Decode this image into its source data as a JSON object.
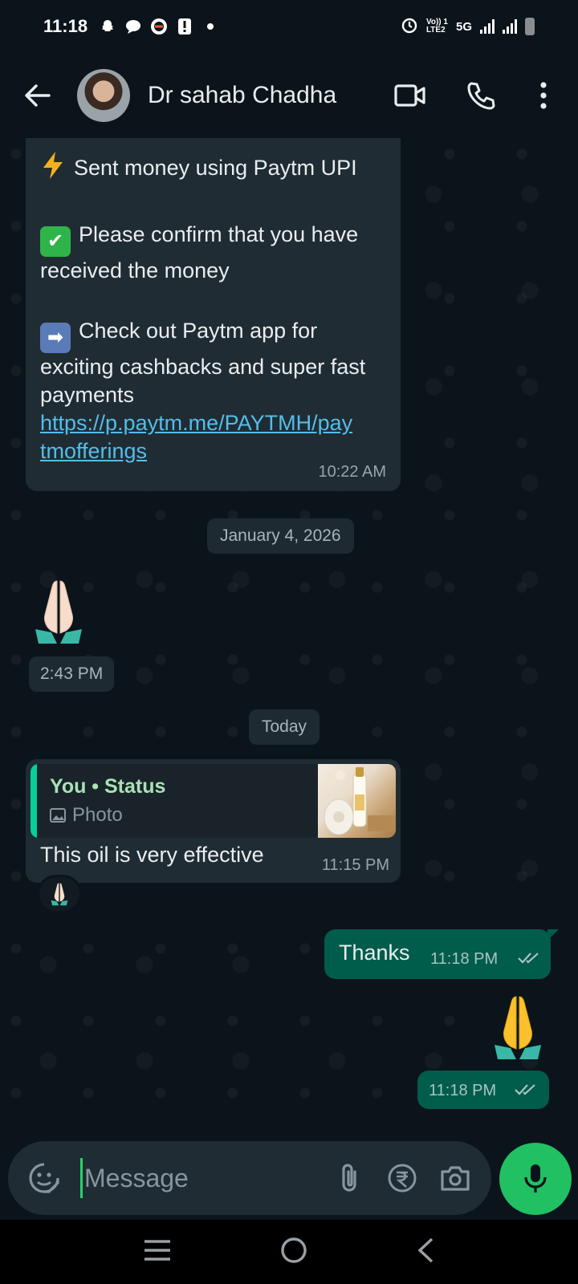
{
  "status_bar": {
    "time": "11:18",
    "network": "5G",
    "volte_top": "Vo)) 1",
    "volte_bottom": "LTE2"
  },
  "header": {
    "contact_name": "Dr sahab Chadha",
    "icons": [
      "back-arrow-icon",
      "video-call-icon",
      "voice-call-icon",
      "more-options-icon"
    ]
  },
  "messages": {
    "paytm": {
      "line1": "Sent money using Paytm UPI",
      "line2": "Please confirm that you have received the money",
      "line3": "Check out Paytm app for exciting cashbacks and super fast payments",
      "link": "https://p.paytm.me/PAYTMH/paytmofferings",
      "time": "10:22 AM"
    },
    "date1": "January 4, 2026",
    "pray_in_time": "2:43 PM",
    "date2": "Today",
    "reply": {
      "quote_author": "You • Status",
      "quote_type": "Photo",
      "text": "This oil is very effective",
      "time": "11:15 PM",
      "reaction": "🙏"
    },
    "thanks": {
      "text": "Thanks",
      "time": "11:18 PM"
    },
    "pray_out_time": "11:18 PM"
  },
  "input": {
    "placeholder": "Message"
  },
  "colors": {
    "background": "#0b141a",
    "incoming_bubble": "#202c33",
    "outgoing_bubble": "#005c4b",
    "accent_green": "#21c063",
    "link": "#53bdeb",
    "quote_author": "#a7e2b5"
  }
}
